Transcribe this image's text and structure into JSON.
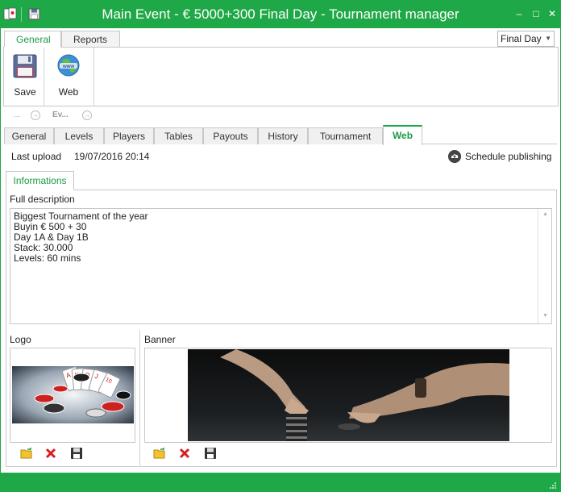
{
  "window": {
    "title": "Main Event - € 5000+300 Final Day - Tournament manager"
  },
  "ribbon": {
    "tabs": [
      {
        "label": "General"
      },
      {
        "label": "Reports"
      }
    ],
    "save_label": "Save",
    "web_label": "Web",
    "day_selector": "Final Day"
  },
  "nav": {
    "prev_label": "...",
    "event_label": "Ev..."
  },
  "tabs": [
    {
      "label": "General"
    },
    {
      "label": "Levels"
    },
    {
      "label": "Players"
    },
    {
      "label": "Tables"
    },
    {
      "label": "Payouts"
    },
    {
      "label": "History"
    },
    {
      "label": "Tournament"
    },
    {
      "label": "Web"
    }
  ],
  "web": {
    "last_upload_label": "Last upload",
    "last_upload_value": "19/07/2016 20:14",
    "schedule_label": "Schedule publishing",
    "subtab_label": "Informations",
    "full_description_label": "Full description",
    "description_lines": [
      "Biggest Tournament of the year",
      "Buyin € 500 + 30",
      "Day 1A & Day 1B",
      "Stack: 30.000",
      "Levels: 60 mins"
    ],
    "logo_label": "Logo",
    "banner_label": "Banner"
  },
  "colors": {
    "accent": "#1fa847",
    "active_text": "#1f9a45"
  }
}
